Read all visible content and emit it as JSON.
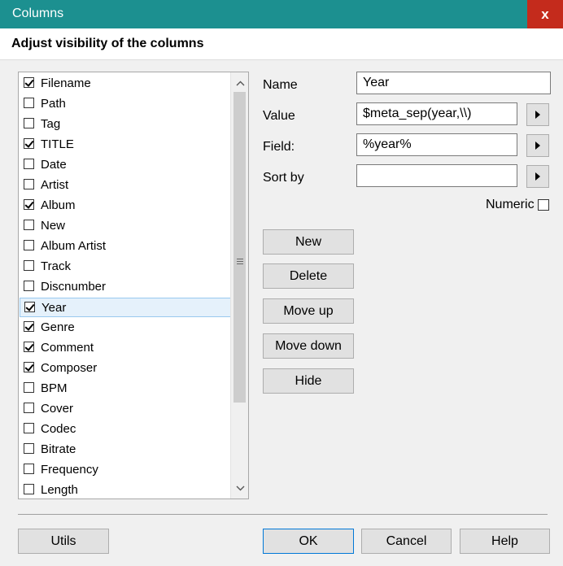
{
  "window": {
    "title": "Columns",
    "close_glyph": "x"
  },
  "header": {
    "text": "Adjust visibility of the columns"
  },
  "columns_list": [
    {
      "label": "Filename",
      "checked": true
    },
    {
      "label": "Path",
      "checked": false
    },
    {
      "label": "Tag",
      "checked": false
    },
    {
      "label": "TITLE",
      "checked": true
    },
    {
      "label": "Date",
      "checked": false
    },
    {
      "label": "Artist",
      "checked": false
    },
    {
      "label": "Album",
      "checked": true
    },
    {
      "label": "New",
      "checked": false
    },
    {
      "label": "Album Artist",
      "checked": false
    },
    {
      "label": "Track",
      "checked": false
    },
    {
      "label": "Discnumber",
      "checked": false
    },
    {
      "label": "Year",
      "checked": true,
      "selected": true
    },
    {
      "label": "Genre",
      "checked": true
    },
    {
      "label": "Comment",
      "checked": true
    },
    {
      "label": "Composer",
      "checked": true
    },
    {
      "label": "BPM",
      "checked": false
    },
    {
      "label": "Cover",
      "checked": false
    },
    {
      "label": "Codec",
      "checked": false
    },
    {
      "label": "Bitrate",
      "checked": false
    },
    {
      "label": "Frequency",
      "checked": false
    },
    {
      "label": "Length",
      "checked": false
    }
  ],
  "form": {
    "name_label": "Name",
    "name_value": "Year",
    "value_label": "Value",
    "value_value": "$meta_sep(year,\\\\)",
    "field_label": "Field:",
    "field_value": "%year%",
    "sortby_label": "Sort by",
    "sortby_value": "",
    "numeric_label": "Numeric",
    "numeric_checked": false
  },
  "actions": {
    "new": "New",
    "delete": "Delete",
    "move_up": "Move up",
    "move_down": "Move down",
    "hide": "Hide"
  },
  "footer": {
    "utils": "Utils",
    "ok": "OK",
    "cancel": "Cancel",
    "help": "Help"
  },
  "colors": {
    "titlebar": "#1c9090",
    "close": "#c42b1c",
    "selection": "#e5f1fb",
    "default_button_border": "#0078d7"
  }
}
